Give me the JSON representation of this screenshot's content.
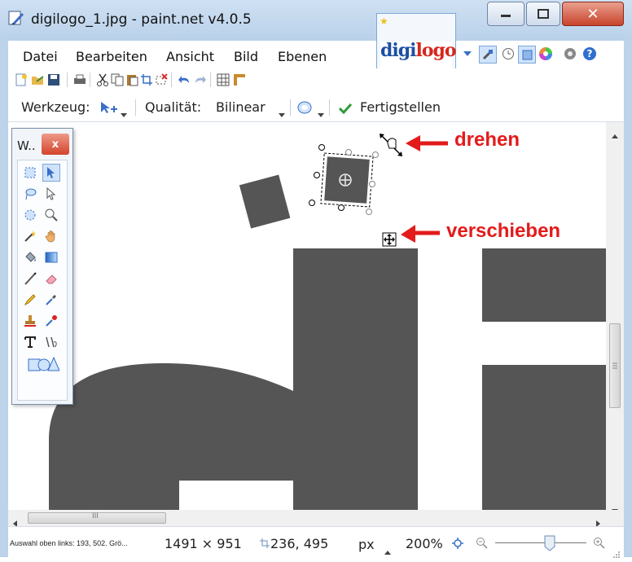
{
  "window": {
    "title": "digilogo_1.jpg - paint.net v4.0.5",
    "minimize_label": "–",
    "maximize_label": "□",
    "close_label": "✕"
  },
  "image_tab": {
    "thumbnail_text_part1": "digi",
    "thumbnail_text_part2": "logo"
  },
  "menu": {
    "items": [
      "Datei",
      "Bearbeiten",
      "Ansicht",
      "Bild",
      "Ebenen"
    ]
  },
  "toolbar": {
    "tool_label": "Werkzeug:",
    "quality_label": "Qualität:",
    "quality_value": "Bilinear",
    "finish_label": "Fertigstellen"
  },
  "tools_window": {
    "title": "W..",
    "close_label": "x"
  },
  "annotations": {
    "rotate": "drehen",
    "move": "verschieben"
  },
  "status": {
    "selection_info": "Auswahl oben links: 193, 502. Grö...",
    "image_size": "1491 × 951",
    "cursor_position": "236, 495",
    "unit": "px",
    "zoom": "200%"
  },
  "scrollbar": {
    "h_thumb_grip": "III"
  },
  "colors": {
    "shape_fill": "#555555",
    "annotation_red": "#e31b1b",
    "logo_blue": "#1d4fa3",
    "logo_red": "#d7261e"
  }
}
